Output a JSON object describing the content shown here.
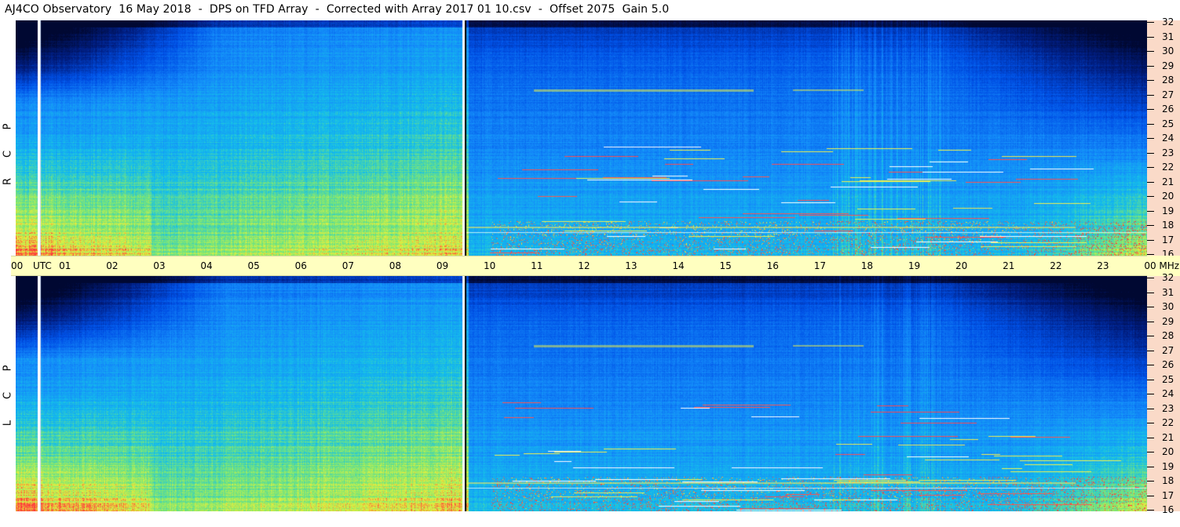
{
  "title": "AJ4CO Observatory  16 May 2018  -  DPS on TFD Array  -  Corrected with Array 2017 01 10.csv  -  Offset 2075  Gain 5.0",
  "panels": [
    {
      "id": "rcp",
      "letters": [
        "R",
        "C",
        "P"
      ]
    },
    {
      "id": "lcp",
      "letters": [
        "L",
        "C",
        "P"
      ]
    }
  ],
  "time_axis": {
    "labels": [
      "00",
      "UTC",
      "01",
      "02",
      "03",
      "04",
      "05",
      "06",
      "07",
      "08",
      "09",
      "10",
      "11",
      "12",
      "13",
      "14",
      "15",
      "16",
      "17",
      "18",
      "19",
      "20",
      "21",
      "22",
      "23",
      "00",
      "MHz"
    ]
  },
  "freq_axis": {
    "labels": [
      "32",
      "31",
      "30",
      "29",
      "28",
      "27",
      "26",
      "25",
      "24",
      "23",
      "22",
      "21",
      "20",
      "19",
      "18",
      "17",
      "16"
    ]
  },
  "colors": {
    "axis_yellow": "#ffffc0",
    "axis_peach": "#fadac8",
    "spectro_dark": "#000a3c",
    "spectro_blue": "#0050e6",
    "spectro_cyan": "#14b4f0",
    "spectro_yellow": "#dcf050",
    "spectro_red": "#ff3c3c"
  }
}
